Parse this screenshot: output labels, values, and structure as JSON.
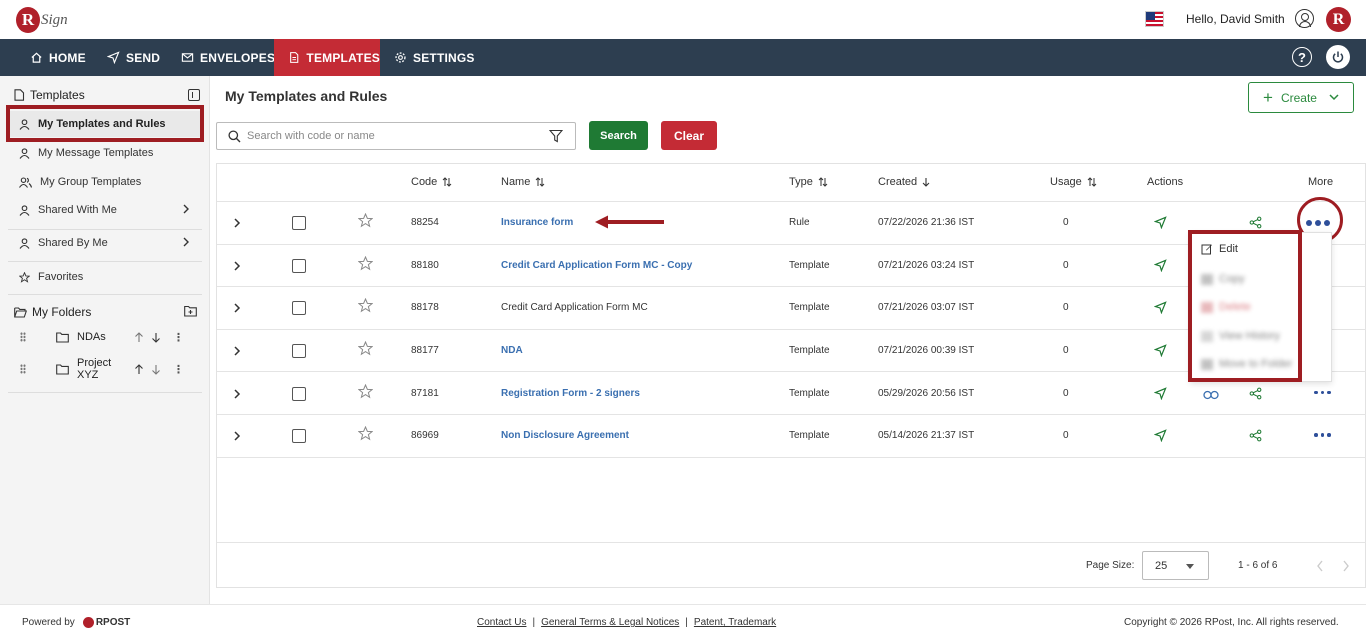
{
  "header": {
    "greeting": "Hello, David Smith",
    "logo_letter": "R",
    "logo_text": "Sign"
  },
  "nav": {
    "items": [
      {
        "label": "HOME",
        "icon": "home-icon"
      },
      {
        "label": "SEND",
        "icon": "send-icon"
      },
      {
        "label": "ENVELOPES",
        "icon": "envelope-icon"
      },
      {
        "label": "TEMPLATES",
        "icon": "document-icon",
        "active": true
      },
      {
        "label": "SETTINGS",
        "icon": "gear-icon"
      }
    ],
    "help": "?"
  },
  "sidebar": {
    "title": "Templates",
    "items": [
      {
        "label": "My Templates and Rules",
        "active": true
      },
      {
        "label": "My Message Templates"
      },
      {
        "label": "My Group Templates"
      },
      {
        "label": "Shared With Me"
      },
      {
        "label": "Shared By Me"
      },
      {
        "label": "Favorites"
      }
    ],
    "folders_title": "My Folders",
    "folders": [
      {
        "name": "NDAs"
      },
      {
        "name": "Project XYZ"
      }
    ]
  },
  "main": {
    "title": "My Templates and Rules",
    "create_label": "Create",
    "search_placeholder": "Search with code or name",
    "search_label": "Search",
    "clear_label": "Clear"
  },
  "table": {
    "columns": [
      "Code",
      "Name",
      "Type",
      "Created",
      "Usage",
      "Actions",
      "More"
    ],
    "rows": [
      {
        "code": "88254",
        "name": "Insurance form",
        "type": "Rule",
        "created": "07/22/2026 21:36 IST",
        "usage": "0",
        "link": true
      },
      {
        "code": "88180",
        "name": "Credit Card Application Form MC - Copy",
        "type": "Template",
        "created": "07/21/2026 03:24 IST",
        "usage": "0",
        "link": true
      },
      {
        "code": "88178",
        "name": "Credit Card Application Form MC",
        "type": "Template",
        "created": "07/21/2026 03:07 IST",
        "usage": "0",
        "link": false
      },
      {
        "code": "88177",
        "name": "NDA",
        "type": "Template",
        "created": "07/21/2026 00:39 IST",
        "usage": "0",
        "link": true
      },
      {
        "code": "87181",
        "name": "Registration Form - 2 signers",
        "type": "Template",
        "created": "05/29/2026 20:56 IST",
        "usage": "0",
        "link": true
      },
      {
        "code": "86969",
        "name": "Non Disclosure Agreement",
        "type": "Template",
        "created": "05/14/2026 21:37 IST",
        "usage": "0",
        "link": true
      }
    ]
  },
  "dropdown": {
    "items": [
      "Edit",
      "Copy",
      "Delete",
      "View History",
      "Move to Folder"
    ]
  },
  "pager": {
    "size_label": "Page Size:",
    "size_value": "25",
    "range": "1 - 6 of 6"
  },
  "footer": {
    "powered": "Powered by",
    "brand": "RPOST",
    "contact": "Contact Us",
    "terms": "General Terms & Legal Notices",
    "patent": "Patent, Trademark",
    "sep": "|",
    "copyright": "Copyright © 2026 RPost, Inc. All rights reserved."
  },
  "colors": {
    "nav_bg": "#2d3e50",
    "accent_red": "#c42b35",
    "highlight": "#9e1d22",
    "green": "#1f7a34",
    "link_blue": "#3a6fb0"
  }
}
